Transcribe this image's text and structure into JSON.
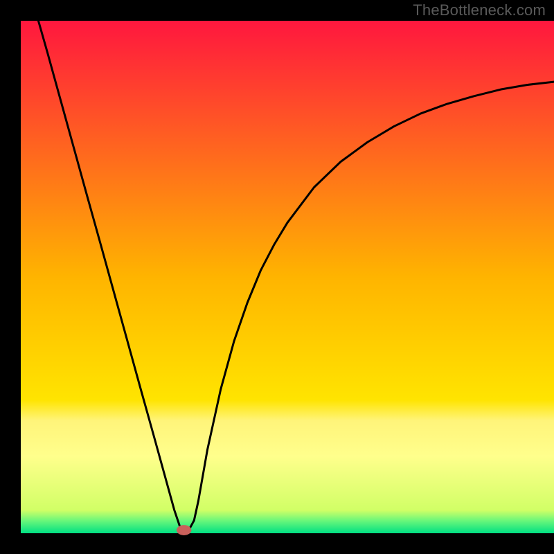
{
  "watermark": "TheBottleneck.com",
  "chart_data": {
    "type": "line",
    "title": "",
    "xlabel": "",
    "ylabel": "",
    "xlim": [
      0,
      100
    ],
    "ylim": [
      0,
      100
    ],
    "background_gradient": {
      "stops": [
        {
          "offset": 0.0,
          "color": "#ff173e"
        },
        {
          "offset": 0.5,
          "color": "#ffb400"
        },
        {
          "offset": 0.74,
          "color": "#ffe400"
        },
        {
          "offset": 0.78,
          "color": "#fff47a"
        },
        {
          "offset": 0.85,
          "color": "#ffff8c"
        },
        {
          "offset": 0.955,
          "color": "#d1ff66"
        },
        {
          "offset": 0.975,
          "color": "#6cf77a"
        },
        {
          "offset": 1.0,
          "color": "#00e083"
        }
      ]
    },
    "series": [
      {
        "name": "bottleneck-curve",
        "color": "#000000",
        "x": [
          3.3,
          5,
          7.5,
          10,
          12.5,
          15,
          17.5,
          20,
          22.5,
          25,
          27.5,
          28.8,
          30,
          31.3,
          32.5,
          33.3,
          35,
          37.5,
          40,
          42.5,
          45,
          47.5,
          50,
          55,
          60,
          65,
          70,
          75,
          80,
          85,
          90,
          95,
          100
        ],
        "y": [
          100,
          93.8,
          84.4,
          75.0,
          65.6,
          56.3,
          46.9,
          37.5,
          28.1,
          18.8,
          9.4,
          4.5,
          0.8,
          0.2,
          2.5,
          6.3,
          16.3,
          28.1,
          37.5,
          45.0,
          51.3,
          56.3,
          60.6,
          67.5,
          72.5,
          76.3,
          79.4,
          81.9,
          83.8,
          85.3,
          86.6,
          87.5,
          88.1
        ]
      }
    ],
    "marker": {
      "name": "minimum-point",
      "x": 30.6,
      "y": 0.6,
      "rx": 1.4,
      "ry": 1.0,
      "color": "#c9605b"
    }
  }
}
